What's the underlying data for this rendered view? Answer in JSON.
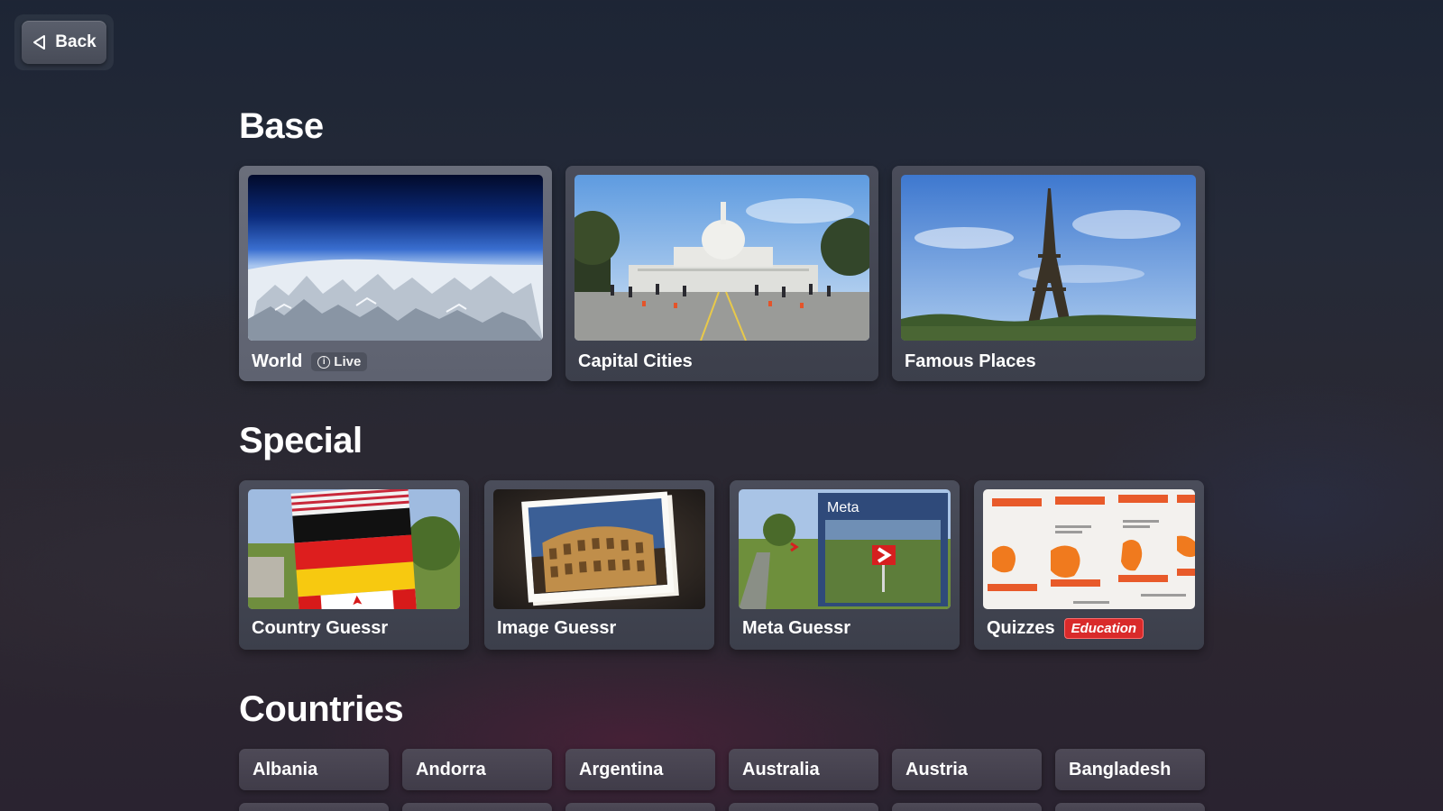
{
  "nav": {
    "back_label": "Back",
    "back_icon": "triangle-left-icon"
  },
  "sections": {
    "base": {
      "title": "Base",
      "cards": [
        {
          "label": "World",
          "badge": "Live",
          "badge_icon": "info-icon"
        },
        {
          "label": "Capital Cities"
        },
        {
          "label": "Famous Places"
        }
      ]
    },
    "special": {
      "title": "Special",
      "cards": [
        {
          "label": "Country Guessr"
        },
        {
          "label": "Image Guessr"
        },
        {
          "label": "Meta Guessr",
          "thumb_text": "Meta"
        },
        {
          "label": "Quizzes",
          "badge": "Education"
        }
      ]
    },
    "countries": {
      "title": "Countries",
      "items": [
        "Albania",
        "Andorra",
        "Argentina",
        "Australia",
        "Austria",
        "Bangladesh"
      ]
    }
  },
  "colors": {
    "education_badge": "#d92a2a",
    "card_bg": "#43464f",
    "background": "#252a38"
  }
}
